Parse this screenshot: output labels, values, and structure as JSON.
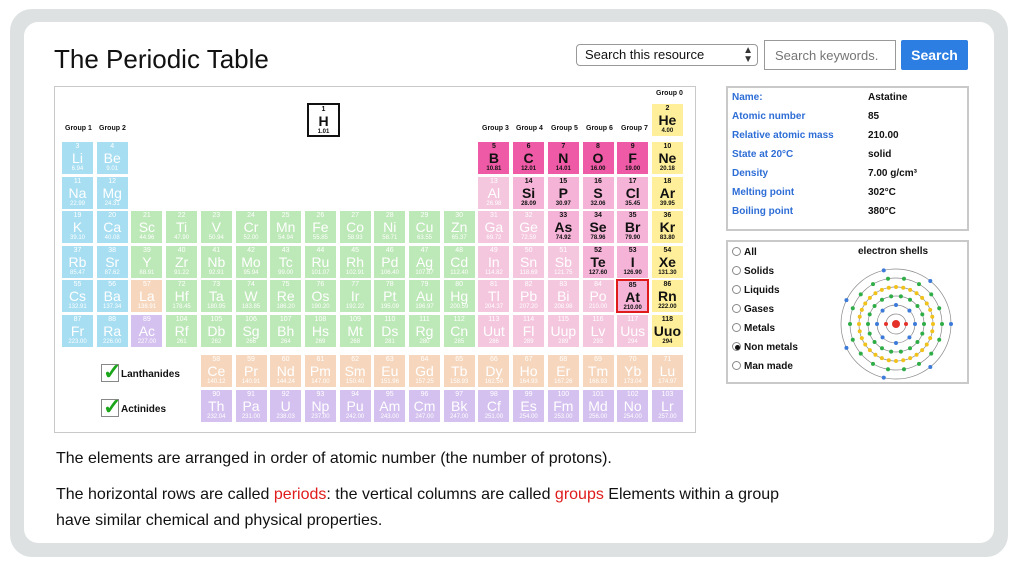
{
  "page": {
    "title": "The Periodic Table"
  },
  "search": {
    "select_label": "Search this resource",
    "placeholder": "Search keywords.",
    "button": "Search"
  },
  "group_labels": {
    "g1": "Group 1",
    "g2": "Group 2",
    "g3": "Group 3",
    "g4": "Group 4",
    "g5": "Group 5",
    "g6": "Group 6",
    "g7": "Group 7",
    "g0": "Group 0"
  },
  "colors": {
    "alkali": "#a7def2",
    "alkaline": "#a7def2",
    "transition": "#bde8b7",
    "metalloid": "#f4b3d7",
    "nonmetal": "#ef5aa6",
    "lanthanide": "#f6d7be",
    "actinide": "#d4c1ef",
    "noble": "#ffef9a",
    "other": "#f4c7de"
  },
  "elements": [
    {
      "z": "1",
      "s": "H",
      "m": "1.01",
      "c": "white",
      "r": 0,
      "g": 9
    },
    {
      "z": "2",
      "s": "He",
      "m": "4.00",
      "c": "noble",
      "r": 0,
      "g": 17,
      "b": true
    },
    {
      "z": "3",
      "s": "Li",
      "m": "6.94",
      "c": "alkali",
      "r": 1,
      "g": 0
    },
    {
      "z": "4",
      "s": "Be",
      "m": "9.01",
      "c": "alkali",
      "r": 1,
      "g": 1
    },
    {
      "z": "5",
      "s": "B",
      "m": "10.81",
      "c": "nonmetal",
      "r": 1,
      "g": 12,
      "b": true
    },
    {
      "z": "6",
      "s": "C",
      "m": "12.01",
      "c": "nonmetal",
      "r": 1,
      "g": 13,
      "b": true
    },
    {
      "z": "7",
      "s": "N",
      "m": "14.01",
      "c": "nonmetal",
      "r": 1,
      "g": 14,
      "b": true
    },
    {
      "z": "8",
      "s": "O",
      "m": "16.00",
      "c": "nonmetal",
      "r": 1,
      "g": 15,
      "b": true
    },
    {
      "z": "9",
      "s": "F",
      "m": "19.00",
      "c": "nonmetal",
      "r": 1,
      "g": 16,
      "b": true
    },
    {
      "z": "10",
      "s": "Ne",
      "m": "20.18",
      "c": "noble",
      "r": 1,
      "g": 17,
      "b": true
    },
    {
      "z": "11",
      "s": "Na",
      "m": "22.99",
      "c": "alkali",
      "r": 2,
      "g": 0
    },
    {
      "z": "12",
      "s": "Mg",
      "m": "24.31",
      "c": "alkali",
      "r": 2,
      "g": 1
    },
    {
      "z": "13",
      "s": "Al",
      "m": "26.98",
      "c": "other",
      "r": 2,
      "g": 12
    },
    {
      "z": "14",
      "s": "Si",
      "m": "28.09",
      "c": "metalloid",
      "r": 2,
      "g": 13,
      "b": true
    },
    {
      "z": "15",
      "s": "P",
      "m": "30.97",
      "c": "metalloid",
      "r": 2,
      "g": 14,
      "b": true
    },
    {
      "z": "16",
      "s": "S",
      "m": "32.06",
      "c": "metalloid",
      "r": 2,
      "g": 15,
      "b": true
    },
    {
      "z": "17",
      "s": "Cl",
      "m": "35.45",
      "c": "metalloid",
      "r": 2,
      "g": 16,
      "b": true
    },
    {
      "z": "18",
      "s": "Ar",
      "m": "39.95",
      "c": "noble",
      "r": 2,
      "g": 17,
      "b": true
    },
    {
      "z": "19",
      "s": "K",
      "m": "39.10",
      "c": "alkali",
      "r": 3,
      "g": 0
    },
    {
      "z": "20",
      "s": "Ca",
      "m": "40.08",
      "c": "alkali",
      "r": 3,
      "g": 1
    },
    {
      "z": "21",
      "s": "Sc",
      "m": "44.96",
      "c": "transition",
      "r": 3,
      "g": 2
    },
    {
      "z": "22",
      "s": "Ti",
      "m": "47.90",
      "c": "transition",
      "r": 3,
      "g": 3
    },
    {
      "z": "23",
      "s": "V",
      "m": "50.94",
      "c": "transition",
      "r": 3,
      "g": 4
    },
    {
      "z": "24",
      "s": "Cr",
      "m": "52.00",
      "c": "transition",
      "r": 3,
      "g": 5
    },
    {
      "z": "25",
      "s": "Mn",
      "m": "54.94",
      "c": "transition",
      "r": 3,
      "g": 6
    },
    {
      "z": "26",
      "s": "Fe",
      "m": "55.85",
      "c": "transition",
      "r": 3,
      "g": 7
    },
    {
      "z": "27",
      "s": "Co",
      "m": "58.93",
      "c": "transition",
      "r": 3,
      "g": 8
    },
    {
      "z": "28",
      "s": "Ni",
      "m": "58.71",
      "c": "transition",
      "r": 3,
      "g": 9
    },
    {
      "z": "29",
      "s": "Cu",
      "m": "63.55",
      "c": "transition",
      "r": 3,
      "g": 10
    },
    {
      "z": "30",
      "s": "Zn",
      "m": "65.37",
      "c": "transition",
      "r": 3,
      "g": 11
    },
    {
      "z": "31",
      "s": "Ga",
      "m": "69.72",
      "c": "other",
      "r": 3,
      "g": 12
    },
    {
      "z": "32",
      "s": "Ge",
      "m": "72.59",
      "c": "other",
      "r": 3,
      "g": 13
    },
    {
      "z": "33",
      "s": "As",
      "m": "74.92",
      "c": "metalloid",
      "r": 3,
      "g": 14,
      "b": true
    },
    {
      "z": "34",
      "s": "Se",
      "m": "78.96",
      "c": "metalloid",
      "r": 3,
      "g": 15,
      "b": true
    },
    {
      "z": "35",
      "s": "Br",
      "m": "79.90",
      "c": "metalloid",
      "r": 3,
      "g": 16,
      "b": true
    },
    {
      "z": "36",
      "s": "Kr",
      "m": "83.80",
      "c": "noble",
      "r": 3,
      "g": 17,
      "b": true
    },
    {
      "z": "37",
      "s": "Rb",
      "m": "85.47",
      "c": "alkali",
      "r": 4,
      "g": 0
    },
    {
      "z": "38",
      "s": "Sr",
      "m": "87.62",
      "c": "alkali",
      "r": 4,
      "g": 1
    },
    {
      "z": "39",
      "s": "Y",
      "m": "88.91",
      "c": "transition",
      "r": 4,
      "g": 2
    },
    {
      "z": "40",
      "s": "Zr",
      "m": "91.22",
      "c": "transition",
      "r": 4,
      "g": 3
    },
    {
      "z": "41",
      "s": "Nb",
      "m": "92.91",
      "c": "transition",
      "r": 4,
      "g": 4
    },
    {
      "z": "42",
      "s": "Mo",
      "m": "95.94",
      "c": "transition",
      "r": 4,
      "g": 5
    },
    {
      "z": "43",
      "s": "Tc",
      "m": "99.00",
      "c": "transition",
      "r": 4,
      "g": 6
    },
    {
      "z": "44",
      "s": "Ru",
      "m": "101.07",
      "c": "transition",
      "r": 4,
      "g": 7
    },
    {
      "z": "45",
      "s": "Rh",
      "m": "102.91",
      "c": "transition",
      "r": 4,
      "g": 8
    },
    {
      "z": "46",
      "s": "Pd",
      "m": "106.40",
      "c": "transition",
      "r": 4,
      "g": 9
    },
    {
      "z": "47",
      "s": "Ag",
      "m": "107.87",
      "c": "transition",
      "r": 4,
      "g": 10
    },
    {
      "z": "48",
      "s": "Cd",
      "m": "112.40",
      "c": "transition",
      "r": 4,
      "g": 11
    },
    {
      "z": "49",
      "s": "In",
      "m": "114.82",
      "c": "other",
      "r": 4,
      "g": 12
    },
    {
      "z": "50",
      "s": "Sn",
      "m": "118.69",
      "c": "other",
      "r": 4,
      "g": 13
    },
    {
      "z": "51",
      "s": "Sb",
      "m": "121.75",
      "c": "other",
      "r": 4,
      "g": 14
    },
    {
      "z": "52",
      "s": "Te",
      "m": "127.60",
      "c": "metalloid",
      "r": 4,
      "g": 15,
      "b": true
    },
    {
      "z": "53",
      "s": "I",
      "m": "126.90",
      "c": "metalloid",
      "r": 4,
      "g": 16,
      "b": true
    },
    {
      "z": "54",
      "s": "Xe",
      "m": "131.30",
      "c": "noble",
      "r": 4,
      "g": 17,
      "b": true
    },
    {
      "z": "55",
      "s": "Cs",
      "m": "132.91",
      "c": "alkali",
      "r": 5,
      "g": 0
    },
    {
      "z": "56",
      "s": "Ba",
      "m": "137.34",
      "c": "alkali",
      "r": 5,
      "g": 1
    },
    {
      "z": "57",
      "s": "La",
      "m": "138.91",
      "c": "lanthanide",
      "r": 5,
      "g": 2
    },
    {
      "z": "72",
      "s": "Hf",
      "m": "178.45",
      "c": "transition",
      "r": 5,
      "g": 3
    },
    {
      "z": "73",
      "s": "Ta",
      "m": "180.95",
      "c": "transition",
      "r": 5,
      "g": 4
    },
    {
      "z": "74",
      "s": "W",
      "m": "183.85",
      "c": "transition",
      "r": 5,
      "g": 5
    },
    {
      "z": "75",
      "s": "Re",
      "m": "186.20",
      "c": "transition",
      "r": 5,
      "g": 6
    },
    {
      "z": "76",
      "s": "Os",
      "m": "190.20",
      "c": "transition",
      "r": 5,
      "g": 7
    },
    {
      "z": "77",
      "s": "Ir",
      "m": "192.22",
      "c": "transition",
      "r": 5,
      "g": 8
    },
    {
      "z": "78",
      "s": "Pt",
      "m": "195.09",
      "c": "transition",
      "r": 5,
      "g": 9
    },
    {
      "z": "79",
      "s": "Au",
      "m": "196.97",
      "c": "transition",
      "r": 5,
      "g": 10
    },
    {
      "z": "80",
      "s": "Hg",
      "m": "200.59",
      "c": "transition",
      "r": 5,
      "g": 11
    },
    {
      "z": "81",
      "s": "Tl",
      "m": "204.37",
      "c": "other",
      "r": 5,
      "g": 12
    },
    {
      "z": "82",
      "s": "Pb",
      "m": "207.20",
      "c": "other",
      "r": 5,
      "g": 13
    },
    {
      "z": "83",
      "s": "Bi",
      "m": "208.98",
      "c": "other",
      "r": 5,
      "g": 14
    },
    {
      "z": "84",
      "s": "Po",
      "m": "210.00",
      "c": "other",
      "r": 5,
      "g": 15
    },
    {
      "z": "85",
      "s": "At",
      "m": "210.00",
      "c": "metalloid",
      "r": 5,
      "g": 16,
      "b": true,
      "sel": true
    },
    {
      "z": "86",
      "s": "Rn",
      "m": "222.00",
      "c": "noble",
      "r": 5,
      "g": 17,
      "b": true
    },
    {
      "z": "87",
      "s": "Fr",
      "m": "223.00",
      "c": "alkali",
      "r": 6,
      "g": 0
    },
    {
      "z": "88",
      "s": "Ra",
      "m": "226.00",
      "c": "alkali",
      "r": 6,
      "g": 1
    },
    {
      "z": "89",
      "s": "Ac",
      "m": "227.00",
      "c": "actinide",
      "r": 6,
      "g": 2
    },
    {
      "z": "104",
      "s": "Rf",
      "m": "261",
      "c": "transition",
      "r": 6,
      "g": 3
    },
    {
      "z": "105",
      "s": "Db",
      "m": "262",
      "c": "transition",
      "r": 6,
      "g": 4
    },
    {
      "z": "106",
      "s": "Sg",
      "m": "266",
      "c": "transition",
      "r": 6,
      "g": 5
    },
    {
      "z": "107",
      "s": "Bh",
      "m": "264",
      "c": "transition",
      "r": 6,
      "g": 6
    },
    {
      "z": "108",
      "s": "Hs",
      "m": "269",
      "c": "transition",
      "r": 6,
      "g": 7
    },
    {
      "z": "109",
      "s": "Mt",
      "m": "268",
      "c": "transition",
      "r": 6,
      "g": 8
    },
    {
      "z": "110",
      "s": "Ds",
      "m": "281",
      "c": "transition",
      "r": 6,
      "g": 9
    },
    {
      "z": "111",
      "s": "Rg",
      "m": "280",
      "c": "transition",
      "r": 6,
      "g": 10
    },
    {
      "z": "112",
      "s": "Cn",
      "m": "285",
      "c": "transition",
      "r": 6,
      "g": 11
    },
    {
      "z": "113",
      "s": "Uut",
      "m": "286",
      "c": "other",
      "r": 6,
      "g": 12
    },
    {
      "z": "114",
      "s": "Fl",
      "m": "289",
      "c": "other",
      "r": 6,
      "g": 13
    },
    {
      "z": "115",
      "s": "Uup",
      "m": "289",
      "c": "other",
      "r": 6,
      "g": 14
    },
    {
      "z": "116",
      "s": "Lv",
      "m": "293",
      "c": "other",
      "r": 6,
      "g": 15
    },
    {
      "z": "117",
      "s": "Uus",
      "m": "294",
      "c": "other",
      "r": 6,
      "g": 16
    },
    {
      "z": "118",
      "s": "Uuo",
      "m": "294",
      "c": "noble",
      "r": 6,
      "g": 17,
      "b": true
    },
    {
      "z": "58",
      "s": "Ce",
      "m": "140.12",
      "c": "lanthanide",
      "r": 7,
      "g": 4
    },
    {
      "z": "59",
      "s": "Pr",
      "m": "140.91",
      "c": "lanthanide",
      "r": 7,
      "g": 5
    },
    {
      "z": "60",
      "s": "Nd",
      "m": "144.24",
      "c": "lanthanide",
      "r": 7,
      "g": 6
    },
    {
      "z": "61",
      "s": "Pm",
      "m": "147.00",
      "c": "lanthanide",
      "r": 7,
      "g": 7
    },
    {
      "z": "62",
      "s": "Sm",
      "m": "150.40",
      "c": "lanthanide",
      "r": 7,
      "g": 8
    },
    {
      "z": "63",
      "s": "Eu",
      "m": "151.96",
      "c": "lanthanide",
      "r": 7,
      "g": 9
    },
    {
      "z": "64",
      "s": "Gd",
      "m": "157.25",
      "c": "lanthanide",
      "r": 7,
      "g": 10
    },
    {
      "z": "65",
      "s": "Tb",
      "m": "158.93",
      "c": "lanthanide",
      "r": 7,
      "g": 11
    },
    {
      "z": "66",
      "s": "Dy",
      "m": "162.50",
      "c": "lanthanide",
      "r": 7,
      "g": 12
    },
    {
      "z": "67",
      "s": "Ho",
      "m": "164.93",
      "c": "lanthanide",
      "r": 7,
      "g": 13
    },
    {
      "z": "68",
      "s": "Er",
      "m": "167.26",
      "c": "lanthanide",
      "r": 7,
      "g": 14
    },
    {
      "z": "69",
      "s": "Tm",
      "m": "168.93",
      "c": "lanthanide",
      "r": 7,
      "g": 15
    },
    {
      "z": "70",
      "s": "Yb",
      "m": "173.04",
      "c": "lanthanide",
      "r": 7,
      "g": 16
    },
    {
      "z": "71",
      "s": "Lu",
      "m": "174.97",
      "c": "lanthanide",
      "r": 7,
      "g": 17
    },
    {
      "z": "90",
      "s": "Th",
      "m": "232.04",
      "c": "actinide",
      "r": 8,
      "g": 4
    },
    {
      "z": "91",
      "s": "Pa",
      "m": "231.00",
      "c": "actinide",
      "r": 8,
      "g": 5
    },
    {
      "z": "92",
      "s": "U",
      "m": "238.03",
      "c": "actinide",
      "r": 8,
      "g": 6
    },
    {
      "z": "93",
      "s": "Np",
      "m": "237.00",
      "c": "actinide",
      "r": 8,
      "g": 7
    },
    {
      "z": "94",
      "s": "Pu",
      "m": "242.00",
      "c": "actinide",
      "r": 8,
      "g": 8
    },
    {
      "z": "95",
      "s": "Am",
      "m": "243.00",
      "c": "actinide",
      "r": 8,
      "g": 9
    },
    {
      "z": "96",
      "s": "Cm",
      "m": "247.00",
      "c": "actinide",
      "r": 8,
      "g": 10
    },
    {
      "z": "97",
      "s": "Bk",
      "m": "247.00",
      "c": "actinide",
      "r": 8,
      "g": 11
    },
    {
      "z": "98",
      "s": "Cf",
      "m": "251.00",
      "c": "actinide",
      "r": 8,
      "g": 12
    },
    {
      "z": "99",
      "s": "Es",
      "m": "254.00",
      "c": "actinide",
      "r": 8,
      "g": 13
    },
    {
      "z": "100",
      "s": "Fm",
      "m": "253.00",
      "c": "actinide",
      "r": 8,
      "g": 14
    },
    {
      "z": "101",
      "s": "Md",
      "m": "256.00",
      "c": "actinide",
      "r": 8,
      "g": 15
    },
    {
      "z": "102",
      "s": "No",
      "m": "254.00",
      "c": "actinide",
      "r": 8,
      "g": 16
    },
    {
      "z": "103",
      "s": "Lr",
      "m": "257.00",
      "c": "actinide",
      "r": 8,
      "g": 17
    }
  ],
  "series_toggles": {
    "lanthanides": "Lanthanides",
    "actinides": "Actinides"
  },
  "info": {
    "rows": [
      {
        "k": "Name:",
        "v": "Astatine"
      },
      {
        "k": "Atomic number",
        "v": "85"
      },
      {
        "k": "Relative atomic mass",
        "v": "210.00"
      },
      {
        "k": "State at 20°C",
        "v": "solid"
      },
      {
        "k": "Density",
        "v": "7.00 g/cm³"
      },
      {
        "k": "Melting point",
        "v": "302°C"
      },
      {
        "k": "Boiling point",
        "v": "380°C"
      }
    ]
  },
  "filters": {
    "options": [
      "All",
      "Solids",
      "Liquids",
      "Gases",
      "Metals",
      "Non metals",
      "Man made"
    ],
    "selected": "Non metals"
  },
  "shells_title": "electron shells",
  "shell_electrons": [
    2,
    8,
    18,
    32,
    18,
    7
  ],
  "text": {
    "p1": "The elements are arranged in order of atomic number (the number of protons).",
    "p2a": "The horizontal rows are called ",
    "p2b": "periods",
    "p2c": ": the vertical columns are called ",
    "p2d": "groups",
    "p2e": " Elements within a group have similar chemical and physical properties."
  }
}
